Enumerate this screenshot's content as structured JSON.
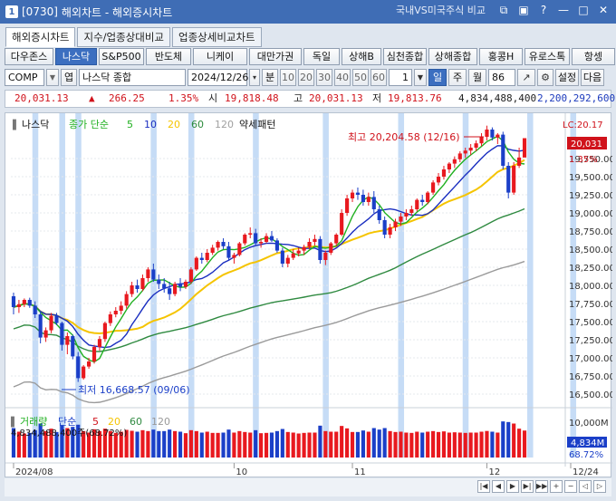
{
  "window": {
    "code": "[0730]",
    "title": "해외차트 - 해외증시차트",
    "compare_label": "국내VS미국주식 비교",
    "icons": [
      "window-link-icon",
      "tile-icon",
      "minimize-icon",
      "maximize-icon",
      "close-icon"
    ]
  },
  "tabs": [
    {
      "label": "해외증시차트",
      "active": true
    },
    {
      "label": "지수/업종상대비교",
      "active": false
    },
    {
      "label": "업종상세비교차트",
      "active": false
    }
  ],
  "index_buttons": [
    {
      "label": "다우존스",
      "selected": false
    },
    {
      "label": "나스닥",
      "selected": true
    },
    {
      "label": "S&P500",
      "selected": false
    },
    {
      "label": "반도체",
      "selected": false
    },
    {
      "label": "니케이",
      "selected": false
    },
    {
      "label": "대만가권",
      "selected": false
    },
    {
      "label": "독일",
      "selected": false
    },
    {
      "label": "상해B",
      "selected": false
    },
    {
      "label": "심천종합",
      "selected": false
    },
    {
      "label": "상해종합",
      "selected": false
    },
    {
      "label": "홍콩H",
      "selected": false
    },
    {
      "label": "유로스톡",
      "selected": false
    },
    {
      "label": "항셍",
      "selected": false
    }
  ],
  "controls": {
    "symbol": "COMP",
    "search_label": "엽",
    "name": "나스닥 종합",
    "date": "2024/12/26",
    "period_unit": "분",
    "minute_options": [
      "10",
      "20",
      "30",
      "40",
      "50",
      "60"
    ],
    "count_value": "1",
    "day_label": "일",
    "week_label": "주",
    "month_label": "월",
    "bars_value": "86",
    "settings_label": "설정",
    "next_label": "다음"
  },
  "quote": {
    "close": "20,031.13",
    "change_arrow": "▲",
    "change": "266.25",
    "change_pct": "1.35%",
    "open_label": "시",
    "open": "19,818.48",
    "high_label": "고",
    "high": "20,031.13",
    "low_label": "저",
    "low": "19,813.76",
    "volume": "4,834,488,400",
    "amount": "2,200,292,600"
  },
  "chart_data": {
    "type": "candlestick",
    "legend": {
      "name": "나스닥",
      "ma_label": "종가 단순",
      "ma_periods": [
        {
          "period": "5",
          "color": "#20b020"
        },
        {
          "period": "10",
          "color": "#1a2ec0"
        },
        {
          "period": "20",
          "color": "#f5c400"
        },
        {
          "period": "60",
          "color": "#2a8a3a"
        },
        {
          "period": "120",
          "color": "#a0a0a0"
        }
      ],
      "pattern_label": "약세패턴"
    },
    "price_axis": {
      "ylim": [
        16375,
        20300
      ],
      "ticks": [
        "19,750.00",
        "19,500.00",
        "19,250.00",
        "19,000.00",
        "18,750.00",
        "18,500.00",
        "18,250.00",
        "18,000.00",
        "17,750.00",
        "17,500.00",
        "17,250.00",
        "17,000.00",
        "16,750.00",
        "16,500.00"
      ],
      "top_label": "LC:20.17",
      "current": "20,031",
      "current_pct": "1.35%"
    },
    "annotations": {
      "high": "최고 20,204.58 (12/16)",
      "low": "최저 16,668.57 (09/06)"
    },
    "x_axis": {
      "labels": [
        {
          "text": "2024/08",
          "index": 0
        },
        {
          "text": "10",
          "index": 41
        },
        {
          "text": "11",
          "index": 63
        },
        {
          "text": "12",
          "index": 88
        },
        {
          "text": "12/24",
          "index": 108
        }
      ]
    },
    "candles_ohlc": [
      [
        17850,
        17900,
        17600,
        17700
      ],
      [
        17700,
        17800,
        17620,
        17740
      ],
      [
        17740,
        17820,
        17700,
        17800
      ],
      [
        17800,
        17830,
        17690,
        17720
      ],
      [
        17720,
        17780,
        17550,
        17600
      ],
      [
        17600,
        17650,
        17200,
        17280
      ],
      [
        17280,
        17420,
        17220,
        17380
      ],
      [
        17380,
        17620,
        17340,
        17580
      ],
      [
        17580,
        17620,
        17450,
        17480
      ],
      [
        17480,
        17500,
        17100,
        17180
      ],
      [
        17180,
        17350,
        17050,
        17300
      ],
      [
        17300,
        17320,
        16980,
        17020
      ],
      [
        17020,
        17080,
        16668,
        16720
      ],
      [
        16720,
        16900,
        16700,
        16880
      ],
      [
        16880,
        17000,
        16850,
        16950
      ],
      [
        16950,
        17180,
        16920,
        17150
      ],
      [
        17150,
        17300,
        17100,
        17260
      ],
      [
        17260,
        17500,
        17220,
        17480
      ],
      [
        17480,
        17640,
        17440,
        17600
      ],
      [
        17600,
        17700,
        17560,
        17650
      ],
      [
        17650,
        17780,
        17600,
        17720
      ],
      [
        17720,
        17920,
        17680,
        17880
      ],
      [
        17880,
        18050,
        17840,
        18000
      ],
      [
        18000,
        18080,
        17900,
        17950
      ],
      [
        17950,
        18150,
        17920,
        18100
      ],
      [
        18100,
        18250,
        18050,
        18220
      ],
      [
        18220,
        18300,
        18050,
        18080
      ],
      [
        18080,
        18150,
        17950,
        18020
      ],
      [
        18020,
        18100,
        17900,
        17960
      ],
      [
        17960,
        18050,
        17800,
        17880
      ],
      [
        17880,
        18050,
        17850,
        18020
      ],
      [
        18020,
        18100,
        17920,
        17980
      ],
      [
        17980,
        18080,
        17950,
        18050
      ],
      [
        18050,
        18250,
        18020,
        18220
      ],
      [
        18220,
        18400,
        18200,
        18380
      ],
      [
        18380,
        18450,
        18300,
        18350
      ],
      [
        18350,
        18500,
        18320,
        18450
      ],
      [
        18450,
        18560,
        18420,
        18520
      ],
      [
        18520,
        18620,
        18480,
        18600
      ],
      [
        18600,
        18650,
        18500,
        18540
      ],
      [
        18540,
        18600,
        18350,
        18380
      ],
      [
        18380,
        18450,
        18300,
        18420
      ],
      [
        18420,
        18600,
        18400,
        18580
      ],
      [
        18580,
        18720,
        18550,
        18700
      ],
      [
        18700,
        18800,
        18650,
        18720
      ],
      [
        18720,
        18780,
        18550,
        18580
      ],
      [
        18580,
        18650,
        18520,
        18600
      ],
      [
        18600,
        18720,
        18580,
        18680
      ],
      [
        18680,
        18750,
        18600,
        18620
      ],
      [
        18620,
        18650,
        18450,
        18480
      ],
      [
        18480,
        18520,
        18250,
        18300
      ],
      [
        18300,
        18420,
        18250,
        18380
      ],
      [
        18380,
        18500,
        18350,
        18440
      ],
      [
        18440,
        18520,
        18400,
        18480
      ],
      [
        18480,
        18560,
        18420,
        18530
      ],
      [
        18530,
        18650,
        18500,
        18600
      ],
      [
        18600,
        18700,
        18550,
        18640
      ],
      [
        18640,
        18680,
        18300,
        18350
      ],
      [
        18350,
        18480,
        18280,
        18450
      ],
      [
        18450,
        18600,
        18420,
        18580
      ],
      [
        18580,
        18720,
        18540,
        18700
      ],
      [
        18700,
        19050,
        18680,
        19000
      ],
      [
        19000,
        19250,
        18960,
        19200
      ],
      [
        19200,
        19320,
        19150,
        19280
      ],
      [
        19280,
        19350,
        19180,
        19250
      ],
      [
        19250,
        19320,
        19100,
        19150
      ],
      [
        19150,
        19280,
        19100,
        19220
      ],
      [
        19220,
        19300,
        19000,
        19050
      ],
      [
        19050,
        19100,
        18850,
        18900
      ],
      [
        18900,
        18950,
        18650,
        18700
      ],
      [
        18700,
        18850,
        18650,
        18800
      ],
      [
        18800,
        18920,
        18750,
        18880
      ],
      [
        18880,
        19000,
        18820,
        18950
      ],
      [
        18950,
        19050,
        18900,
        19000
      ],
      [
        19000,
        19100,
        18960,
        19050
      ],
      [
        19050,
        19200,
        19020,
        19180
      ],
      [
        19180,
        19250,
        19100,
        19150
      ],
      [
        19150,
        19300,
        19120,
        19280
      ],
      [
        19280,
        19450,
        19250,
        19420
      ],
      [
        19420,
        19550,
        19380,
        19500
      ],
      [
        19500,
        19650,
        19460,
        19600
      ],
      [
        19600,
        19700,
        19550,
        19680
      ],
      [
        19680,
        19780,
        19620,
        19740
      ],
      [
        19740,
        19850,
        19700,
        19820
      ],
      [
        19820,
        19900,
        19760,
        19860
      ],
      [
        19860,
        19950,
        19800,
        19900
      ],
      [
        19900,
        20000,
        19850,
        19960
      ],
      [
        19960,
        20100,
        19920,
        20050
      ],
      [
        20050,
        20204,
        20000,
        20150
      ],
      [
        20150,
        20180,
        20000,
        20040
      ],
      [
        20040,
        20100,
        19950,
        20080
      ],
      [
        20080,
        20120,
        19600,
        19650
      ],
      [
        19650,
        19700,
        19200,
        19280
      ],
      [
        19280,
        19700,
        19250,
        19650
      ],
      [
        19650,
        19900,
        19620,
        19764
      ],
      [
        19764,
        20031,
        19813,
        20031
      ]
    ],
    "volume_axis": {
      "ticks": [
        "10,000M"
      ],
      "current": "4,834M",
      "current_pct": "68.72%"
    },
    "volume_legend": {
      "name": "거래량",
      "ma_label": "단순",
      "periods": [
        "5",
        "20",
        "60",
        "120"
      ],
      "value": "4,834,488,400주(68.72%)"
    }
  },
  "bottom_nav": [
    "first-icon",
    "prev-icon",
    "play-icon",
    "next-icon",
    "last-icon",
    "zoom-in-icon",
    "zoom-out-icon",
    "scroll-left-icon",
    "scroll-right-icon"
  ]
}
